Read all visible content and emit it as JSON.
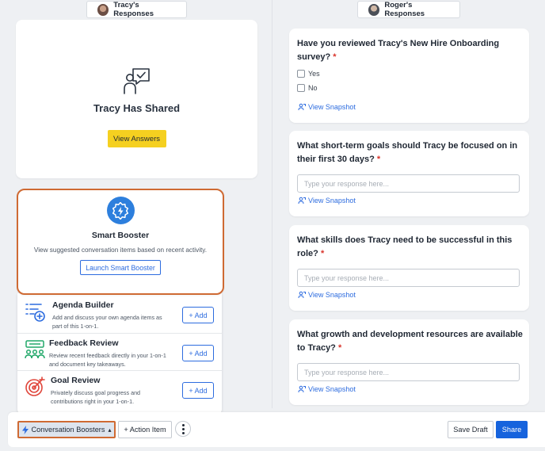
{
  "left_header": {
    "name": "Tracy's Responses"
  },
  "right_header": {
    "name": "Roger's Responses"
  },
  "shared_card": {
    "title": "Tracy Has Shared",
    "button": "View Answers"
  },
  "smart_booster": {
    "title": "Smart Booster",
    "description": "View suggested conversation items based on recent activity.",
    "button": "Launch Smart Booster"
  },
  "tools": [
    {
      "name": "Agenda Builder",
      "description": "Add and discuss your own agenda items as part of this 1-on-1.",
      "button": "+ Add",
      "icon": "list-add-icon"
    },
    {
      "name": "Feedback Review",
      "description": "Review recent feedback directly in your 1-on-1 and document key takeaways.",
      "button": "+ Add",
      "icon": "feedback-group-icon"
    },
    {
      "name": "Goal Review",
      "description": "Privately discuss goal progress and contributions right in your 1-on-1.",
      "button": "+ Add",
      "icon": "target-icon"
    }
  ],
  "questions": [
    {
      "text": "Have you reviewed Tracy's New Hire Onboarding survey?",
      "required": "*",
      "options": [
        "Yes",
        "No"
      ],
      "snapshot": "View Snapshot"
    },
    {
      "text": "What short-term goals should Tracy be focused on in their first 30 days?",
      "required": "*",
      "placeholder": "Type your response here...",
      "snapshot": "View Snapshot"
    },
    {
      "text": "What skills does Tracy need to be successful in this role?",
      "required": "*",
      "placeholder": "Type your response here...",
      "snapshot": "View Snapshot"
    },
    {
      "text": "What growth and development resources are available to Tracy?",
      "required": "*",
      "placeholder": "Type your response here...",
      "snapshot": "View Snapshot"
    }
  ],
  "bottom_bar": {
    "boosters": "Conversation Boosters",
    "boosters_caret": "▴",
    "action_item": "+ Action Item",
    "save_draft": "Save Draft",
    "share": "Share"
  },
  "colors": {
    "accent_blue": "#2d6cdf",
    "share_blue": "#1663dd",
    "highlight_orange": "#cf6a33",
    "view_answers_yellow": "#f5d020",
    "required_red": "#d9342b"
  }
}
